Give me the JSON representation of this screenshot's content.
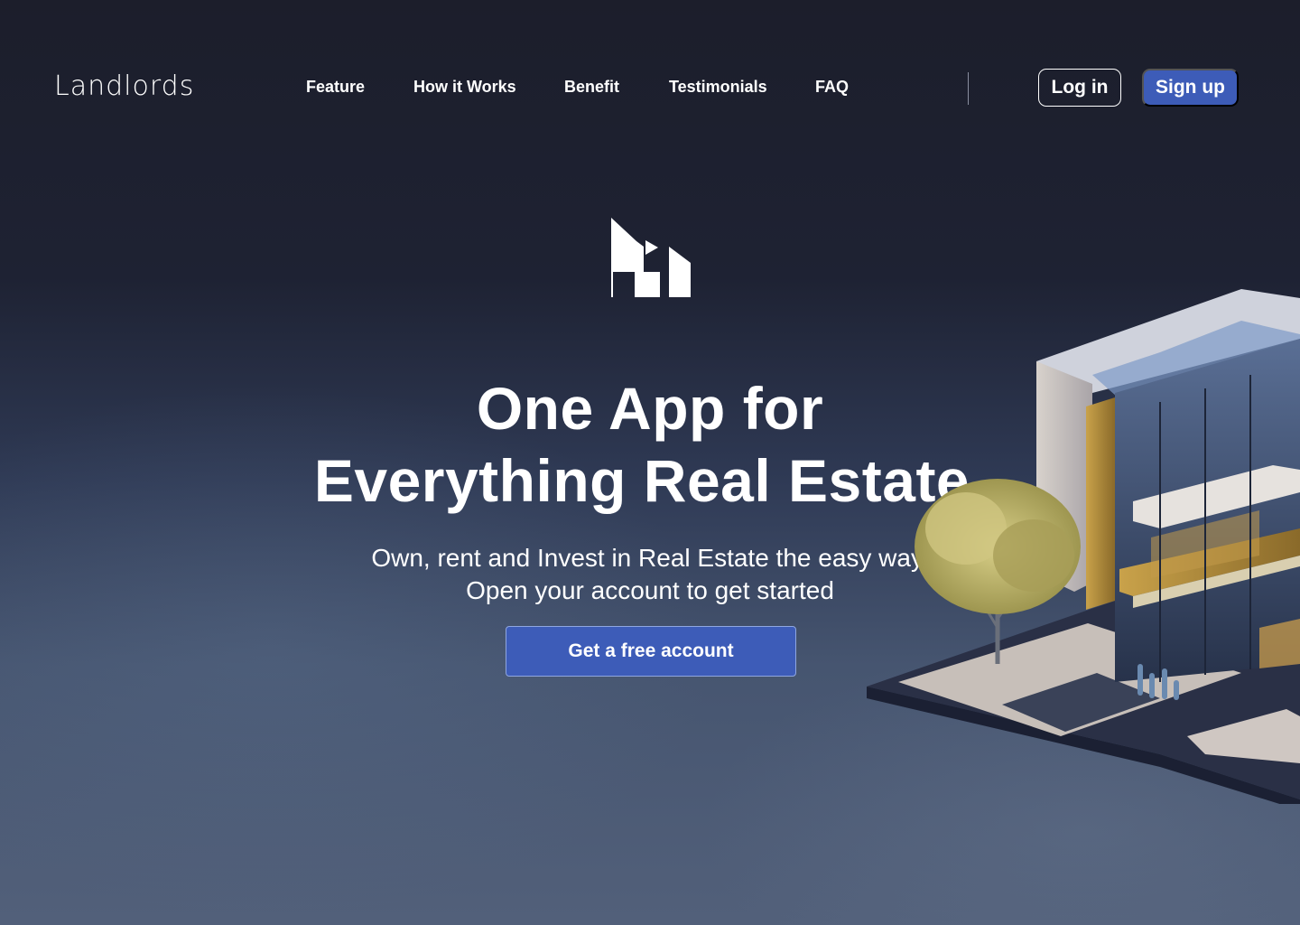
{
  "brand": {
    "logo_text": "Landlords"
  },
  "nav": {
    "links": [
      "Feature",
      "How it Works",
      "Benefit",
      "Testimonials",
      "FAQ"
    ],
    "login_label": "Log in",
    "signup_label": "Sign up"
  },
  "hero": {
    "title_line1": "One App for",
    "title_line2": "Everything Real Estate",
    "subtitle_line1": "Own, rent and Invest in Real Estate the easy way.",
    "subtitle_line2": "Open your account to get started",
    "cta_label": "Get a free account"
  },
  "icons": [
    "landlords-logo-mark-icon",
    "house-illustration"
  ],
  "colors": {
    "primary_button": "#3d5cb8",
    "background_top": "#1c1e2b",
    "background_bottom": "#52607a",
    "text": "#ffffff"
  }
}
